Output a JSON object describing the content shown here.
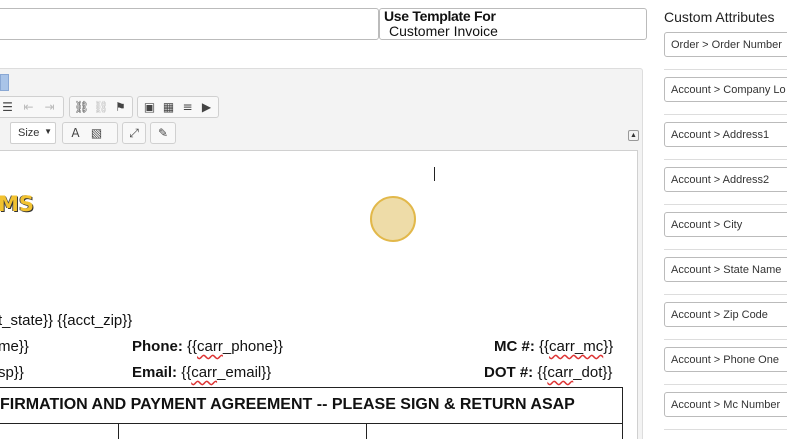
{
  "template": {
    "label": "Use Template For",
    "value": "Customer Invoice"
  },
  "toolbar": {
    "size_label": "Size"
  },
  "document": {
    "logo_text": "MS",
    "address_line": "t_state}} {{acct_zip}}",
    "row1_left": "me}}",
    "phone_label": "Phone:",
    "phone_prefix": "{{",
    "phone_var": "carr",
    "phone_suffix": "_phone}}",
    "mc_label": "MC #:",
    "mc_prefix": "{{",
    "mc_var": "carr_mc",
    "mc_suffix": "}}",
    "row2_left": "sp}}",
    "email_label": "Email:",
    "email_prefix": "{{",
    "email_var": "carr",
    "email_suffix": "_email}}",
    "dot_label": "DOT #:",
    "dot_prefix": "{{",
    "dot_var": "carr",
    "dot_suffix": "_dot}}",
    "agreement_title": "FIRMATION AND PAYMENT AGREEMENT -- PLEASE SIGN & RETURN ASAP"
  },
  "attributes": {
    "title": "Custom Attributes",
    "items": [
      "Order > Order Number",
      "Account > Company Lo",
      "Account > Address1",
      "Account > Address2",
      "Account > City",
      "Account > State Name",
      "Account > Zip Code",
      "Account > Phone One",
      "Account > Mc Number"
    ]
  }
}
